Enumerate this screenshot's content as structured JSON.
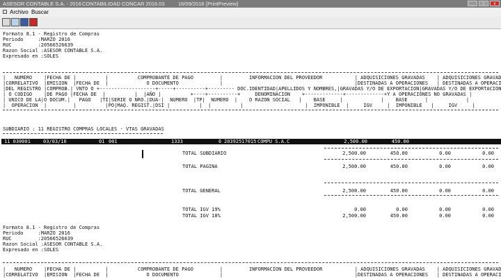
{
  "titlebar": {
    "app": "ASESOR CONTABLE S.A. - 2016",
    "module": "CONTABILIDAD CONCAR 2016.03",
    "date": "16/09/2016",
    "view": "[PrintPreview]",
    "min": "_",
    "max": "□",
    "close": "x"
  },
  "menu": {
    "archivo": "Archivo",
    "buscar": "Buscar"
  },
  "toolbar": {
    "icons": [
      "print-icon",
      "search-icon",
      "save-icon",
      "exit-icon"
    ]
  },
  "report": {
    "header": [
      "Formato 8.1 - Registro de Compras",
      "Periodo     :MARZO 2016",
      "RUC         :20566526639",
      "Razon Social :ASESOR CONTABLE S.A.",
      "Expresado en :SOLES"
    ],
    "cols": [
      "|   NUMERO    |FECHA DE |          |          COMPROBANTE DE PAGO         |         INFORMACION DEL PROVEEDOR           | ADQUISICIONES GRAVADAS    | ADQUISICIONES GRAVADAS   |",
      "|CORRELATIVO  |EMISION  |FECHA DE  |             O DOCUMENTO              |                                             |DESTINADAS A OPERACIONES   | DESTINADAS A OPERACIONES |",
      "|DEL REGISTRO |COMPROB.| VNTO O +-------------------+-----+----------+--------- DOC.IDENTIDAD|APELLIDOS Y NOMBRES,|GRAVADAS Y/O DE EXPORTACION|GRAVADAS Y/O DE EXPORTACION |",
      "| O CODIGO    |DE PAGO |FECHA DE  |          |  |AÑO |          +----+----------+     DENOMINACION    +-------------+-------------+Y A OPERACIONES NO GRAVADAS |",
      "| UNICO DE LA|O DOCUM.|   PAGO   |TI|SERIE O NRO.|DUA-|  NUMERO  |TP|  NUMERO  |    O RAZON SOCIAL   |    BASE     |             |    BASE      |             |",
      "|  OPERACION  |         |          |PO|MAQ. REGIST.|DSI |          |  |          |                     |  IMPONIBLE  |     IGV     |  IMPONIBLE   |     IGV     |"
    ],
    "cols2": [
      "|   NUMERO    |FECHA DE |          |          COMPROBANTE DE PAGO         |         INFORMACION DEL PROVEEDOR           | ADQUISICIONES GRAVADAS    | ADQUISICIONES GRAVADAS   |",
      "|CORRELATIVO  |EMISION  |FECHA DE  |             O DOCUMENTO              |                                             |DESTINADAS A OPERACIONES   | DESTINADAS A OPERACIONES |"
    ],
    "subdiario": "SUBDIARIO : 11 REGISTRO COMPRAS LOCALES - VTAS GRAVADAS",
    "row": {
      "correlativo": "11 030001",
      "fecha": "03/03/16",
      "tipo": "01",
      "serie": "001",
      "numero": "1333",
      "tp": "6",
      "ruc": "20392517015",
      "razon": "COMPU S.A.C",
      "base": "2,500.00",
      "igv": "450.00"
    },
    "totals": [
      {
        "label": "TOTAL SUBDIARIO",
        "c1": "2,500.00",
        "c2": "450.00",
        "c3": "0.00",
        "c4": "0.00"
      },
      {
        "label": "TOTAL PAGINA",
        "c1": "2,500.00",
        "c2": "450.00",
        "c3": "0.00",
        "c4": "0.00"
      },
      {
        "label": "TOTAL GENERAL",
        "c1": "2,500.00",
        "c2": "450.00",
        "c3": "0.00",
        "c4": "0.00"
      },
      {
        "label": "TOTAL IGV 19%",
        "c1": "0.00",
        "c2": "0.00",
        "c3": "0.00",
        "c4": "0.00"
      },
      {
        "label": "TOTAL IGV 18%",
        "c1": "2,500.00",
        "c2": "450.00",
        "c3": "0.00",
        "c4": "0.00"
      }
    ]
  }
}
